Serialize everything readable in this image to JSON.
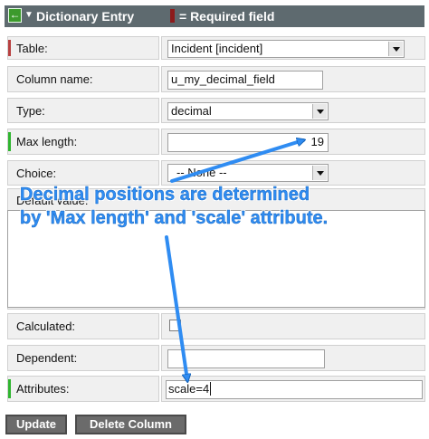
{
  "header": {
    "back_icon": "back-arrow-icon",
    "menu_icon": "dropdown-triangle-icon",
    "title": "Dictionary Entry",
    "required_legend": "= Required field",
    "required_color": "#8d1b1b"
  },
  "form": {
    "table_label": "Table:",
    "table_value": "Incident [incident]",
    "column_name_label": "Column name:",
    "column_name_value": "u_my_decimal_field",
    "type_label": "Type:",
    "type_value": "decimal",
    "max_length_label": "Max length:",
    "max_length_value": "19",
    "choice_label": "Choice:",
    "choice_value": "-- None --",
    "default_value_label": "Default value:",
    "calculated_label": "Calculated:",
    "calculated_checked": false,
    "dependent_label": "Dependent:",
    "dependent_value": "",
    "attributes_label": "Attributes:",
    "attributes_value": "scale=4"
  },
  "buttons": {
    "update": "Update",
    "delete_column": "Delete Column"
  },
  "annotation": {
    "line1": "Decimal positions are determined",
    "line2": "by 'Max length' and 'scale' attribute.",
    "color": "#2f8cf2"
  },
  "colors": {
    "mandatory_mark": "#b84040",
    "valid_mark": "#2fb52f",
    "header_bg": "#5e6a6f",
    "button_bg": "#6b6b6b"
  }
}
